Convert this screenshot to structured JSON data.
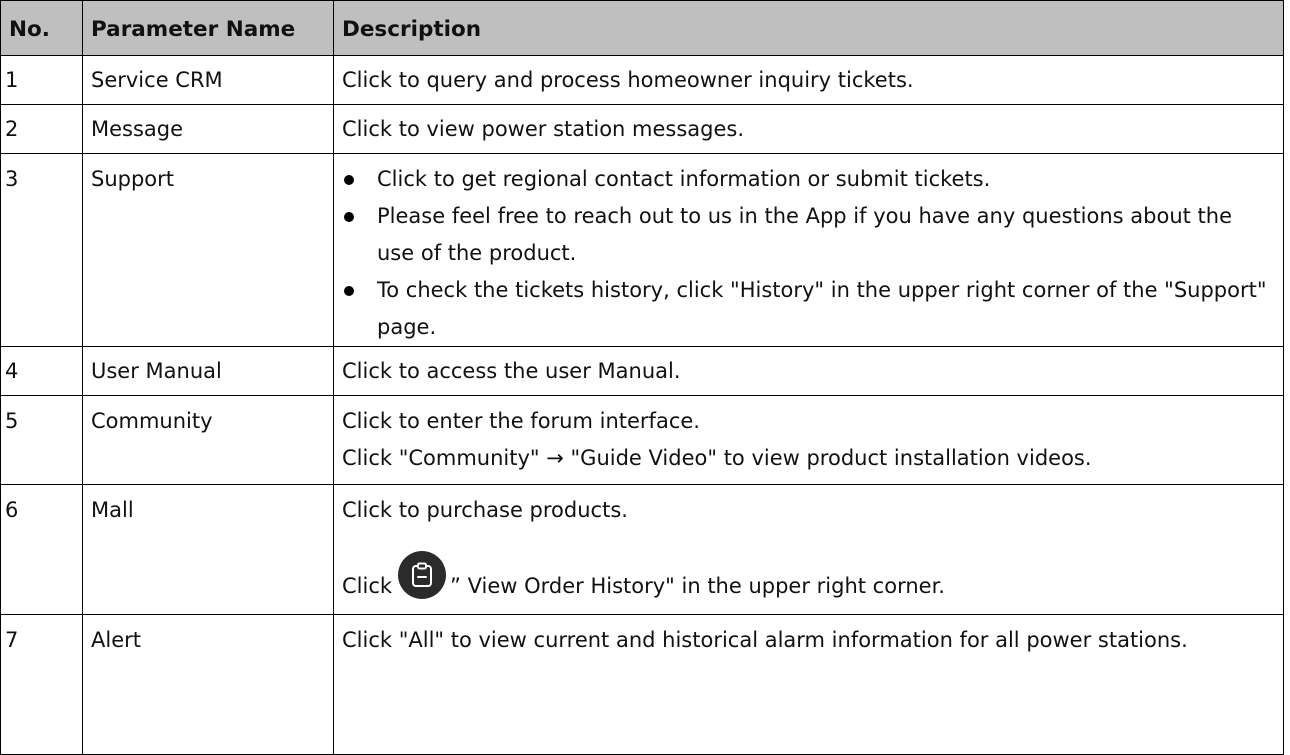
{
  "table": {
    "headers": {
      "no": "No.",
      "name": "Parameter Name",
      "desc": "Description"
    },
    "rows": [
      {
        "no": "1",
        "name": "Service CRM",
        "desc": "Click to query and process homeowner inquiry tickets."
      },
      {
        "no": "2",
        "name": "Message",
        "desc": "Click to view power station messages."
      },
      {
        "no": "3",
        "name": "Support",
        "bullets": [
          "Click to get regional contact information or submit tickets.",
          "Please feel free to reach out to us in the App if you have any questions about the use of the product.",
          "To check the tickets history, click \"History\" in the upper right corner of the \"Support\" page."
        ]
      },
      {
        "no": "4",
        "name": "User Manual",
        "desc": "Click to access the user Manual."
      },
      {
        "no": "5",
        "name": "Community",
        "desc": "Click to enter the forum interface.",
        "desc2": "Click \"Community\" → \"Guide Video\" to view product installation videos."
      },
      {
        "no": "6",
        "name": "Mall",
        "desc": "Click to purchase products.",
        "desc2_prefix": "Click",
        "desc2_suffix": "” View Order History\" in the upper right corner.",
        "icon": "order-history-icon"
      },
      {
        "no": "7",
        "name": "Alert",
        "desc": "Click \"All\" to view current and historical alarm information for all power stations."
      }
    ]
  }
}
